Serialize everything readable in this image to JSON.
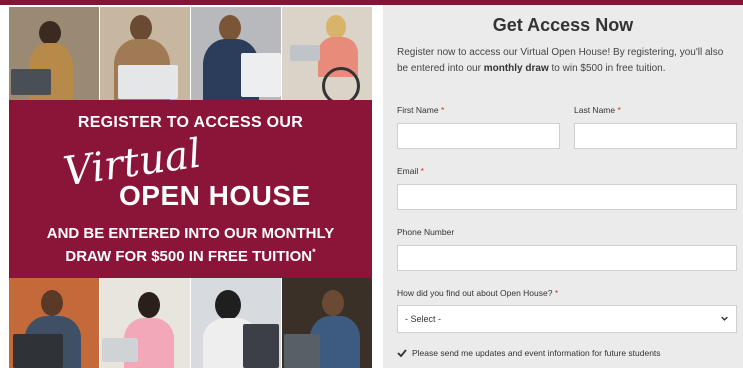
{
  "banner": {
    "line1": "REGISTER TO ACCESS OUR",
    "script": "Virtual",
    "open_house": "OPEN HOUSE",
    "line3a": "AND BE ENTERED INTO OUR MONTHLY",
    "line3b": "DRAW FOR $500 IN FREE TUITION",
    "asterisk": "*"
  },
  "form": {
    "title": "Get Access Now",
    "intro_prefix": "Register now to access our Virtual Open House! By registering, you'll also be entered into our ",
    "intro_bold": "monthly draw",
    "intro_suffix": " to win $500 in free tuition.",
    "first_name_label": "First Name",
    "last_name_label": "Last Name",
    "email_label": "Email",
    "phone_label": "Phone Number",
    "source_label": "How did you find out about Open House?",
    "required_mark": "*",
    "source_selected": "- Select -",
    "updates_label": "Please send me updates and event information for future students",
    "updates_checked": true
  },
  "colors": {
    "brand": "#8b1538",
    "panel": "#ebebeb",
    "required": "#c0392b"
  }
}
